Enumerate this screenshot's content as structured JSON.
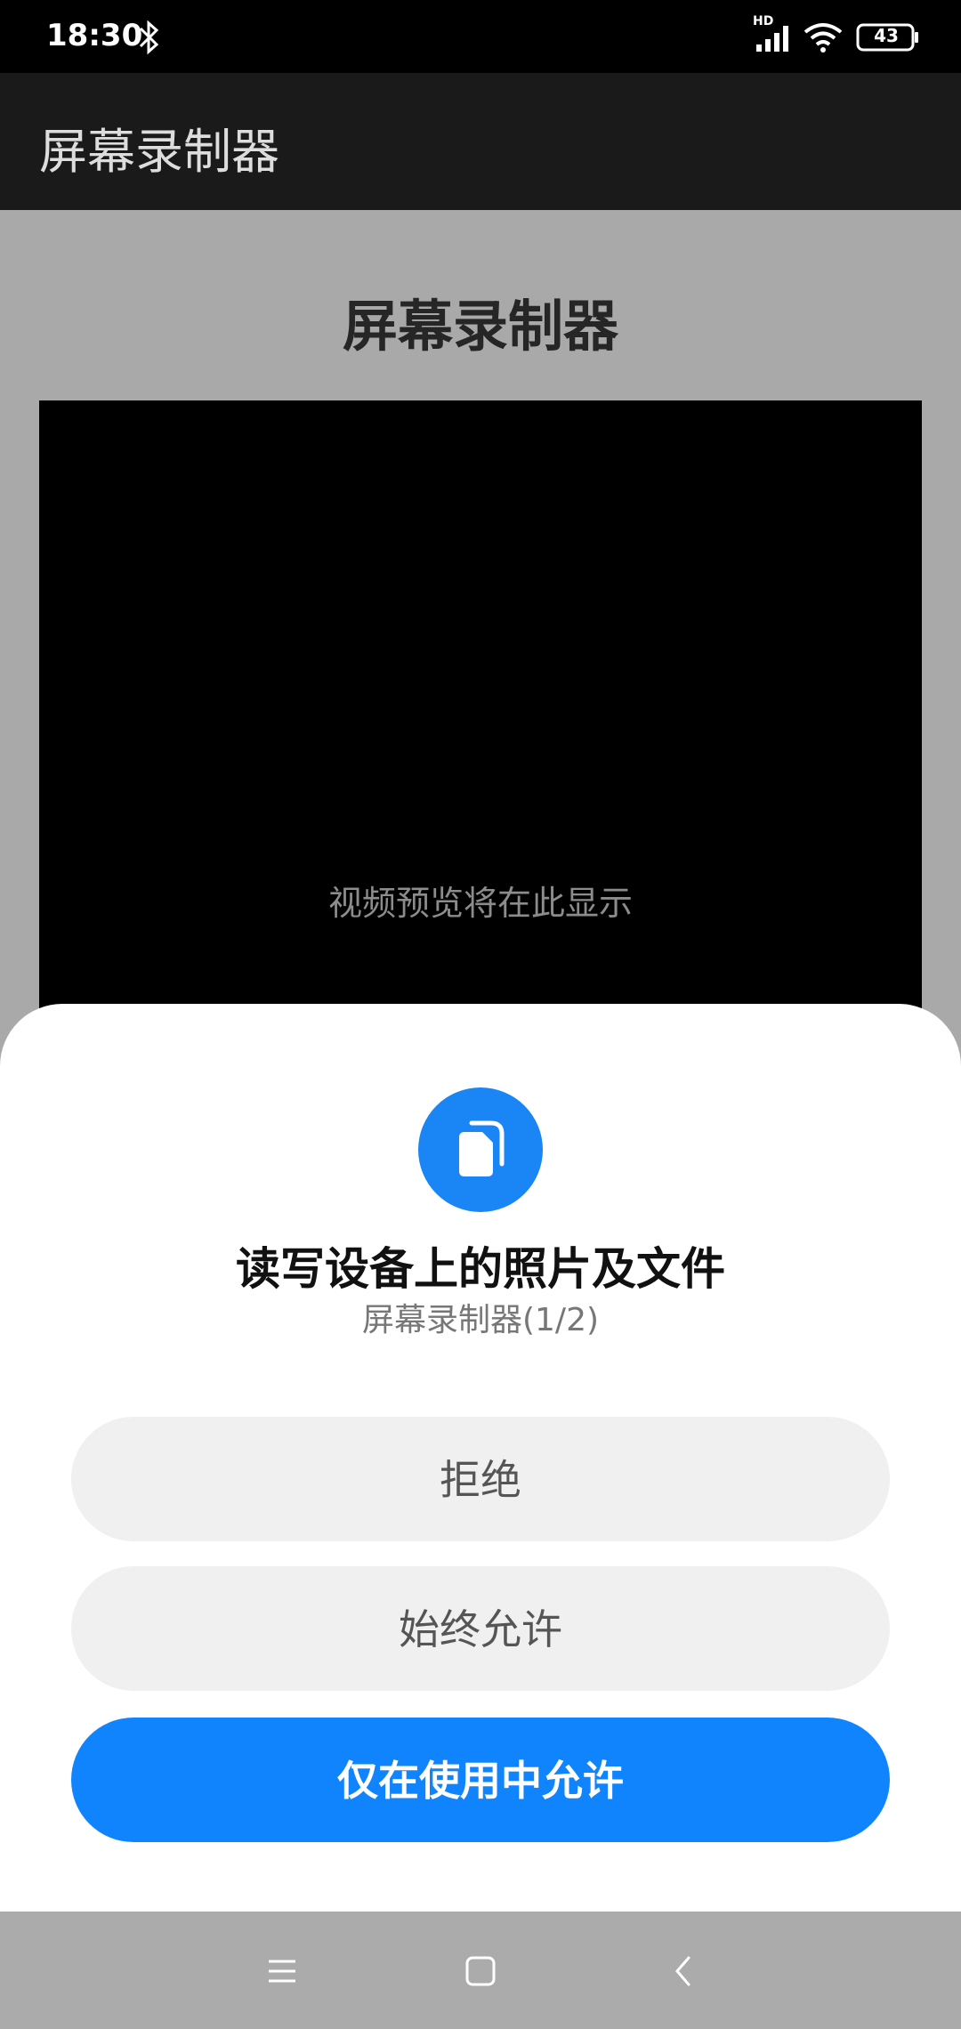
{
  "status_bar": {
    "time": "18:30",
    "network_label": "HD",
    "battery": "43",
    "icons": [
      "bluetooth-icon",
      "signal-icon",
      "wifi-icon",
      "battery-icon"
    ]
  },
  "app_bar": {
    "title": "屏幕录制器"
  },
  "main": {
    "heading": "屏幕录制器",
    "preview_placeholder": "视频预览将在此显示"
  },
  "permission_dialog": {
    "icon": "files-icon",
    "title": "读写设备上的照片及文件",
    "subtitle": "屏幕录制器(1/2)",
    "buttons": {
      "deny": "拒绝",
      "always_allow": "始终允许",
      "allow_while_using": "仅在使用中允许"
    }
  },
  "nav_bar": {
    "icons": [
      "menu-icon",
      "home-icon",
      "back-icon"
    ]
  },
  "colors": {
    "accent": "#0f84fd",
    "icon_circle": "#1a86f5",
    "scrim": "#a9a9a9",
    "secondary_button": "#f0f0f0"
  }
}
